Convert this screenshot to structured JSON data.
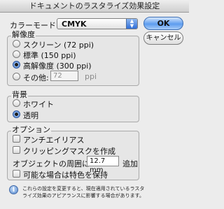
{
  "window": {
    "title": "ドキュメントのラスタライズ効果設定"
  },
  "color_mode": {
    "label": "カラーモード:",
    "value": "CMYK"
  },
  "buttons": {
    "ok": "OK",
    "cancel": "キャンセル"
  },
  "resolution": {
    "title": "解像度",
    "options": [
      {
        "label": "スクリーン (72 ppi)",
        "selected": false
      },
      {
        "label": "標準 (150 ppi)",
        "selected": false
      },
      {
        "label": "高解像度 (300 ppi)",
        "selected": true
      }
    ],
    "other": {
      "label": "その他:",
      "value": "72",
      "unit": "ppi",
      "selected": false
    }
  },
  "background": {
    "title": "背景",
    "options": [
      {
        "label": "ホワイト",
        "selected": false
      },
      {
        "label": "透明",
        "selected": true
      }
    ]
  },
  "options": {
    "title": "オプション",
    "antialias": {
      "label": "アンチエイリアス",
      "checked": false
    },
    "clipping_mask": {
      "label": "クリッピングマスクを作成",
      "checked": false
    },
    "around_object": {
      "label": "オブジェクトの周囲に",
      "value": "12.7 mm",
      "suffix": "追加"
    },
    "spot_colors": {
      "label": "可能な場合は特色を保持",
      "checked": false
    }
  },
  "info": {
    "icon": "info-icon",
    "line1": "これらの設定を変更すると、現在適用されているラスタ",
    "line2": "ライズ効果のアピアランスに影響する場合があります。"
  }
}
